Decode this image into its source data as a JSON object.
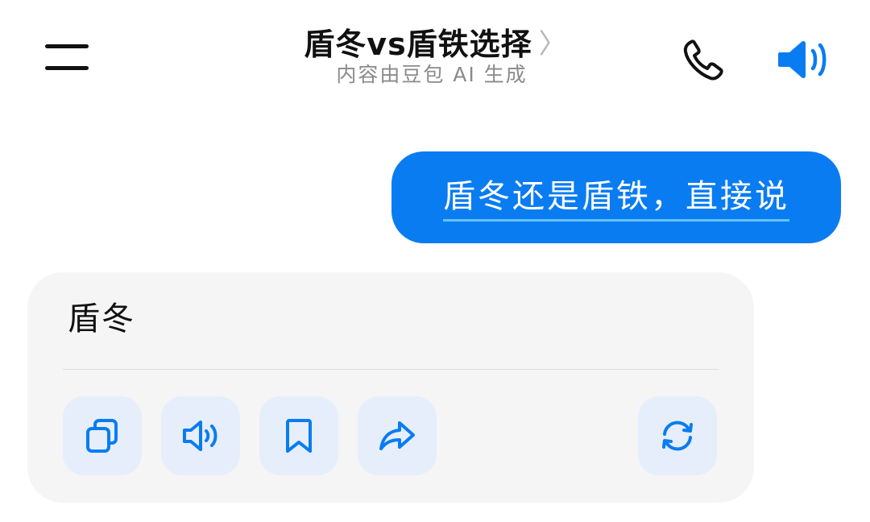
{
  "header": {
    "title": "盾冬vs盾铁选择",
    "chevron": "〉",
    "subtitle": "内容由豆包 AI 生成",
    "icons": {
      "menu": "menu-icon",
      "phone": "phone-icon",
      "speaker": "speaker-icon"
    }
  },
  "conversation": {
    "user_message": "盾冬还是盾铁，直接说",
    "ai_reply": "盾冬"
  },
  "actions": [
    {
      "name": "copy",
      "icon": "copy-icon"
    },
    {
      "name": "read-aloud",
      "icon": "speaker-icon"
    },
    {
      "name": "bookmark",
      "icon": "bookmark-icon"
    },
    {
      "name": "share",
      "icon": "share-icon"
    },
    {
      "name": "regenerate",
      "icon": "refresh-icon"
    }
  ],
  "colors": {
    "accent": "#0a7cf2",
    "user_bubble": "#0a7cf2",
    "card_bg": "#f5f5f5",
    "action_bg": "#e6eefb"
  }
}
